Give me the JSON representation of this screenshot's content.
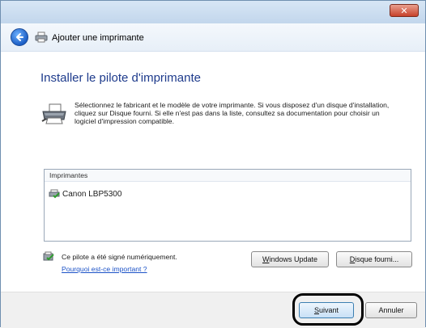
{
  "window": {
    "title": "Ajouter une imprimante",
    "close_symbol": "✕"
  },
  "page": {
    "heading": "Installer le pilote d'imprimante",
    "description": "Sélectionnez le fabricant et le modèle de votre imprimante. Si vous disposez d'un disque d'installation, cliquez sur Disque fourni. Si elle n'est pas dans la liste, consultez sa documentation pour choisir un logiciel d'impression compatible."
  },
  "list": {
    "header": "Imprimantes",
    "items": [
      {
        "label": "Canon LBP5300",
        "icon": "printer-icon"
      }
    ]
  },
  "driver": {
    "signed_text": "Ce pilote a été signé numériquement.",
    "why_link": "Pourquoi est-ce important ?"
  },
  "buttons": {
    "windows_update": {
      "underlined": "W",
      "rest": "indows Update"
    },
    "disk": {
      "underlined": "D",
      "rest": "isque fourni..."
    },
    "next": {
      "underlined": "S",
      "rest": "uivant"
    },
    "cancel": "Annuler"
  },
  "icons": {
    "back": "back-arrow-icon",
    "header_printer": "printer-icon",
    "big_printer": "printer-icon",
    "signed": "certified-driver-icon"
  },
  "colors": {
    "heading": "#1e3b8c",
    "link": "#1b52c7",
    "close": "#c7412a"
  }
}
